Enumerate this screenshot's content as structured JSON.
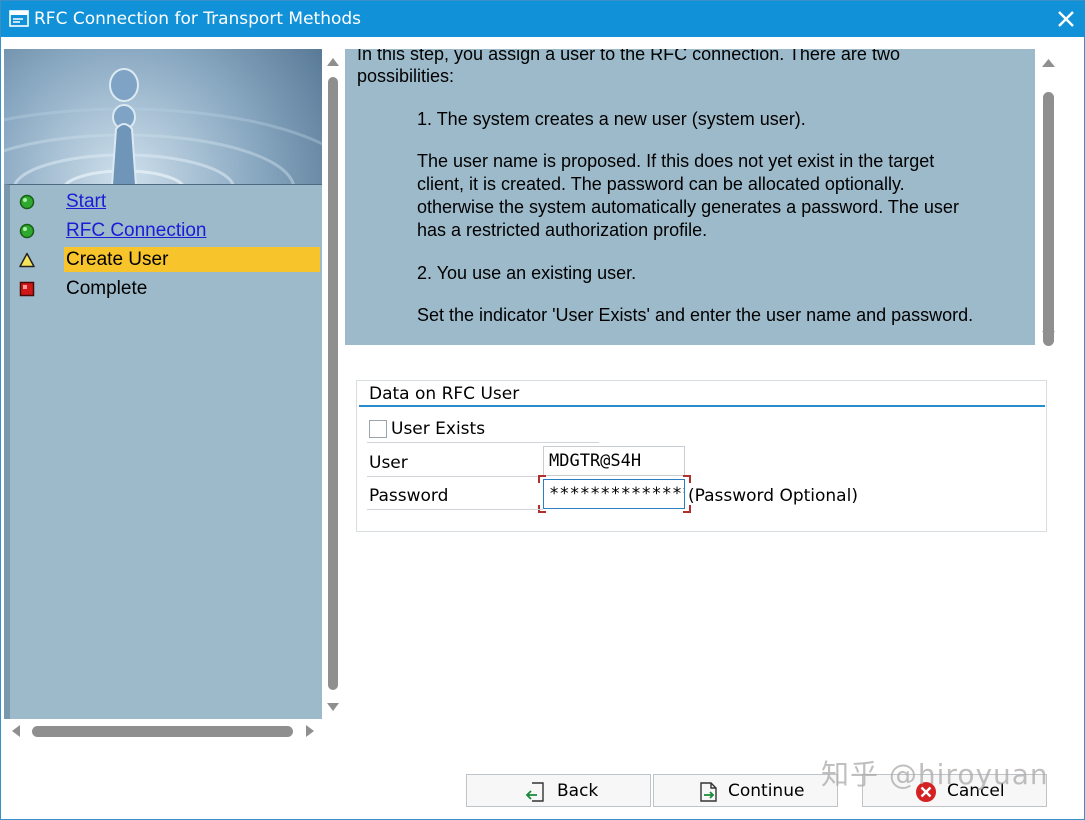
{
  "window": {
    "title": "RFC Connection for Transport Methods",
    "accent": "#1192d8"
  },
  "nav": {
    "items": [
      {
        "label": "Start",
        "status": "green",
        "link": true
      },
      {
        "label": "RFC Connection",
        "status": "green",
        "link": true
      },
      {
        "label": "Create User",
        "status": "yellow-triangle",
        "active": true
      },
      {
        "label": "Complete",
        "status": "red"
      }
    ]
  },
  "info": {
    "line_intro_1": "In this step, you assign a user to the RFC connection. There are two",
    "line_intro_2": "possibilities:",
    "option1": "1. The system creates a new user (system user).",
    "option1_detail": [
      "The user name is proposed. If this does not yet exist in the target",
      "client, it is created. The password can be allocated optionally.",
      "otherwise the system automatically generates a password. The user",
      "has a restricted authorization profile."
    ],
    "option2": "2. You use an existing user.",
    "option2_detail": "Set the indicator 'User Exists' and enter the user name and password."
  },
  "form": {
    "group_title": "Data on RFC User",
    "user_exists_label": "User Exists",
    "user_exists_checked": false,
    "user_label": "User",
    "user_value": "MDGTR@S4H",
    "password_label": "Password",
    "password_value": "**************",
    "password_hint": "(Password Optional)"
  },
  "buttons": {
    "back": "Back",
    "continue": "Continue",
    "cancel": "Cancel"
  },
  "watermark": "知乎 @hiroyuan"
}
